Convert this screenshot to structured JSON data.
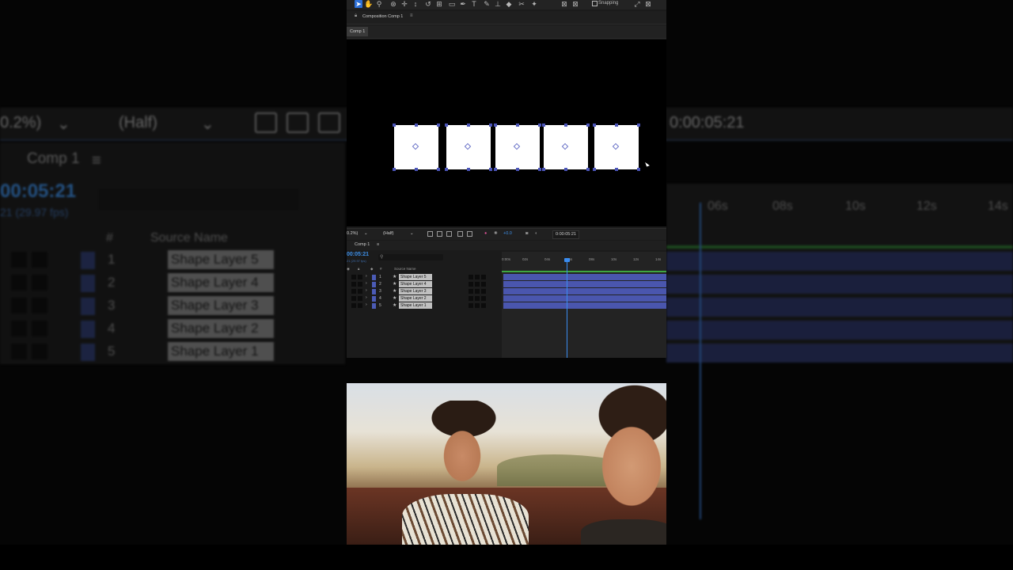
{
  "colors": {
    "accent_blue": "#3d8fe8",
    "layer_bar": "#4a56ae",
    "work_area": "#3ea641",
    "panel_bg": "#1b1b1b"
  },
  "toolbar": {
    "snapping_label": "Snapping",
    "tools": [
      "selection-icon",
      "hand-icon",
      "zoom-icon",
      "orbit-icon",
      "pan-icon",
      "dolly-icon",
      "rotate-icon",
      "anchor-icon",
      "rectangle-icon",
      "pen-icon",
      "type-icon",
      "brush-icon",
      "stamp-icon",
      "eraser-icon",
      "roto-icon",
      "puppet-icon"
    ]
  },
  "composition_panel": {
    "title": "Composition Comp 1",
    "tab": "Comp 1"
  },
  "viewer_bar": {
    "zoom": "0.2%)",
    "resolution": "(Half)",
    "exposure": "+0.0",
    "timecode": "0:00:05:21"
  },
  "timeline": {
    "title": "Comp 1",
    "timecode": "00:05:21",
    "fps": "21 (29.97 fps)",
    "search_placeholder": "",
    "column_hash": "#",
    "column_source": "Source Name",
    "ruler": [
      "0:00s",
      "02s",
      "04s",
      "06s",
      "08s",
      "10s",
      "12s",
      "14s"
    ],
    "layers": [
      {
        "index": "1",
        "name": "Shape Layer 5"
      },
      {
        "index": "2",
        "name": "Shape Layer 4"
      },
      {
        "index": "3",
        "name": "Shape Layer 3"
      },
      {
        "index": "4",
        "name": "Shape Layer 2"
      },
      {
        "index": "5",
        "name": "Shape Layer 1"
      }
    ]
  },
  "background": {
    "zoom": "0.2%)",
    "resolution": "(Half)",
    "comp_title": "Comp 1",
    "timecode": "00:05:21",
    "fps": "21 (29.97 fps)",
    "right_timecode": "0:00:05:21",
    "hash": "#",
    "source_name": "Source Name",
    "ruler": [
      "06s",
      "08s",
      "10s",
      "12s",
      "14s"
    ]
  }
}
